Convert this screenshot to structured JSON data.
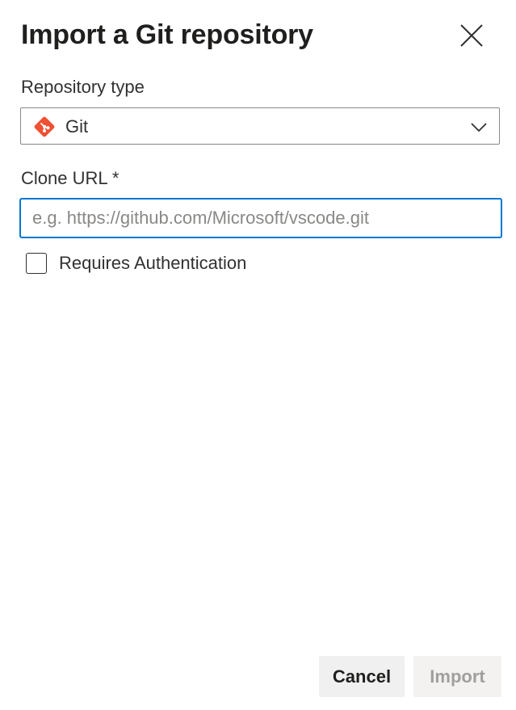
{
  "dialog": {
    "title": "Import a Git repository",
    "close_icon": "close-icon"
  },
  "repository_type": {
    "label": "Repository type",
    "selected_value": "Git",
    "icon": "git-logo-icon",
    "icon_color": "#f05033",
    "dropdown_icon": "chevron-down-icon"
  },
  "clone_url": {
    "label": "Clone URL *",
    "value": "",
    "placeholder": "e.g. https://github.com/Microsoft/vscode.git",
    "focus_color": "#0078d4"
  },
  "authentication": {
    "label": "Requires Authentication",
    "checked": false
  },
  "footer": {
    "cancel_label": "Cancel",
    "import_label": "Import",
    "import_disabled": true
  }
}
